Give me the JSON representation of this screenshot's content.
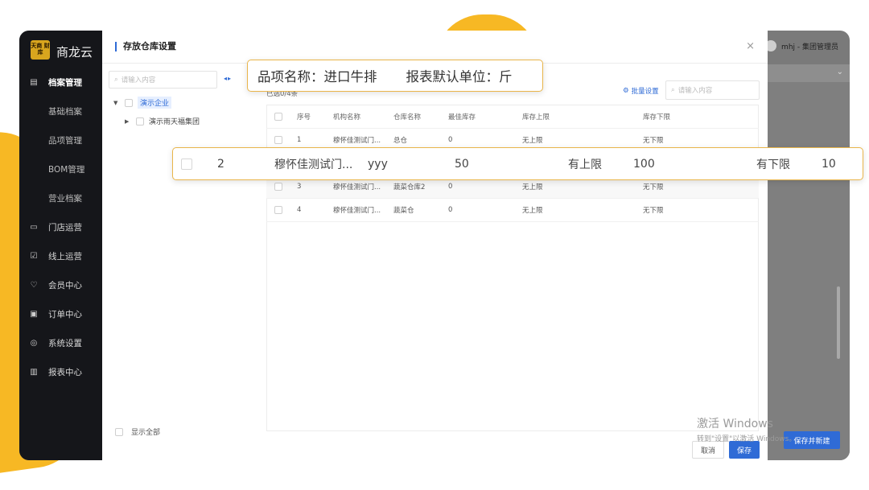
{
  "app": {
    "logo_glyph": "天商 财库",
    "logo_text": "商龙云",
    "user": "mhj - 集团管理员",
    "save_new_label": "保存并新建"
  },
  "sidebar": {
    "items": [
      {
        "label": "档案管理",
        "icon": "archive-icon"
      },
      {
        "label": "基础档案"
      },
      {
        "label": "品项管理"
      },
      {
        "label": "BOM管理"
      },
      {
        "label": "营业档案"
      },
      {
        "label": "门店运营",
        "icon": "store-icon"
      },
      {
        "label": "线上运营",
        "icon": "online-icon"
      },
      {
        "label": "会员中心",
        "icon": "member-icon"
      },
      {
        "label": "订单中心",
        "icon": "order-icon"
      },
      {
        "label": "系统设置",
        "icon": "settings-icon"
      },
      {
        "label": "报表中心",
        "icon": "report-icon"
      }
    ]
  },
  "modal": {
    "title": "存放仓库设置",
    "close": "×",
    "tree_search_placeholder": "请输入内容",
    "tree_arrows": "◂▸",
    "tree": [
      {
        "label": "演示企业"
      },
      {
        "label": "演示雨天福集团"
      }
    ],
    "show_all": "显示全部",
    "selected_count": "已选0/4条",
    "batch_set": "批量设置",
    "table_search_placeholder": "请输入内容",
    "columns": {
      "no": "序号",
      "org": "机构名称",
      "warehouse": "仓库名称",
      "best": "最佳库存",
      "max": "库存上限",
      "min": "库存下限"
    },
    "rows": [
      {
        "no": "1",
        "org": "穆怀佳测试门...",
        "warehouse": "总仓",
        "best": "0",
        "max": "无上限",
        "min": "无下限"
      },
      {
        "no": "3",
        "org": "穆怀佳测试门...",
        "warehouse": "蔬菜仓库2",
        "best": "0",
        "max": "无上限",
        "min": "无下限"
      },
      {
        "no": "4",
        "org": "穆怀佳测试门...",
        "warehouse": "蔬菜仓",
        "best": "0",
        "max": "无上限",
        "min": "无下限"
      }
    ],
    "cancel": "取消",
    "save": "保存"
  },
  "callout_product": {
    "name_text": "品项名称：进口牛排",
    "unit_text": "报表默认单位：斤"
  },
  "callout_row": {
    "no": "2",
    "org": "穆怀佳测试门...",
    "warehouse": "yyy",
    "best": "50",
    "max_label": "有上限",
    "max_value": "100",
    "min_label": "有下限",
    "min_value": "10"
  },
  "watermark": {
    "line1": "激活 Windows",
    "line2": "转到\"设置\"以激活 Windows。"
  },
  "colors": {
    "accent": "#2f6bd6",
    "callout_border": "#e9b54a",
    "sidebar_bg": "#15161a",
    "blob": "#f7b824"
  }
}
